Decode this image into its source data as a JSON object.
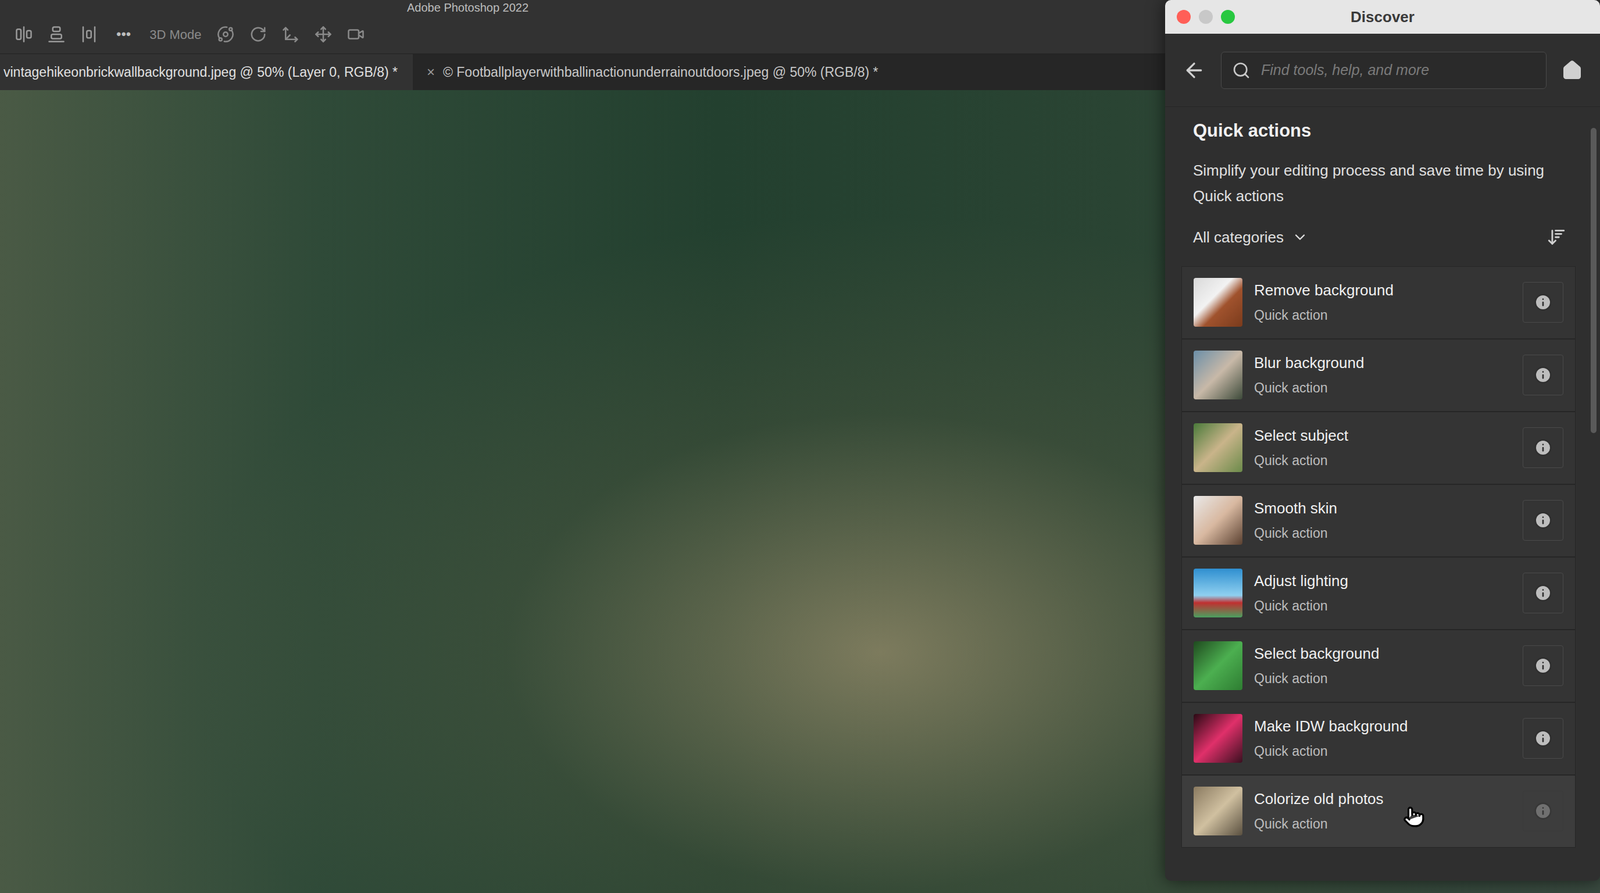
{
  "app": {
    "title": "Adobe Photoshop 2022"
  },
  "toolbar": {
    "more": "•••",
    "mode_label": "3D Mode"
  },
  "tabs": [
    {
      "label": "vintagehikeonbrickwallbackground.jpeg @ 50% (Layer 0, RGB/8) *",
      "close": "",
      "selected": true
    },
    {
      "label": "© Footballplayerwithballinactionunderrainoutdoors.jpeg @ 50% (RGB/8) *",
      "close": "×",
      "selected": false
    }
  ],
  "discover": {
    "title": "Discover",
    "search": {
      "placeholder": "Find tools, help, and more"
    },
    "heading": "Quick actions",
    "description": "Simplify your editing process and save time by using Quick actions",
    "filter": "All categories",
    "items": [
      {
        "name": "Remove background",
        "subtitle": "Quick action",
        "hovered": false
      },
      {
        "name": "Blur background",
        "subtitle": "Quick action",
        "hovered": false
      },
      {
        "name": "Select subject",
        "subtitle": "Quick action",
        "hovered": false
      },
      {
        "name": "Smooth skin",
        "subtitle": "Quick action",
        "hovered": false
      },
      {
        "name": "Adjust lighting",
        "subtitle": "Quick action",
        "hovered": false
      },
      {
        "name": "Select background",
        "subtitle": "Quick action",
        "hovered": false
      },
      {
        "name": "Make IDW background",
        "subtitle": "Quick action",
        "hovered": false
      },
      {
        "name": "Colorize old photos",
        "subtitle": "Quick action",
        "hovered": true
      }
    ]
  }
}
